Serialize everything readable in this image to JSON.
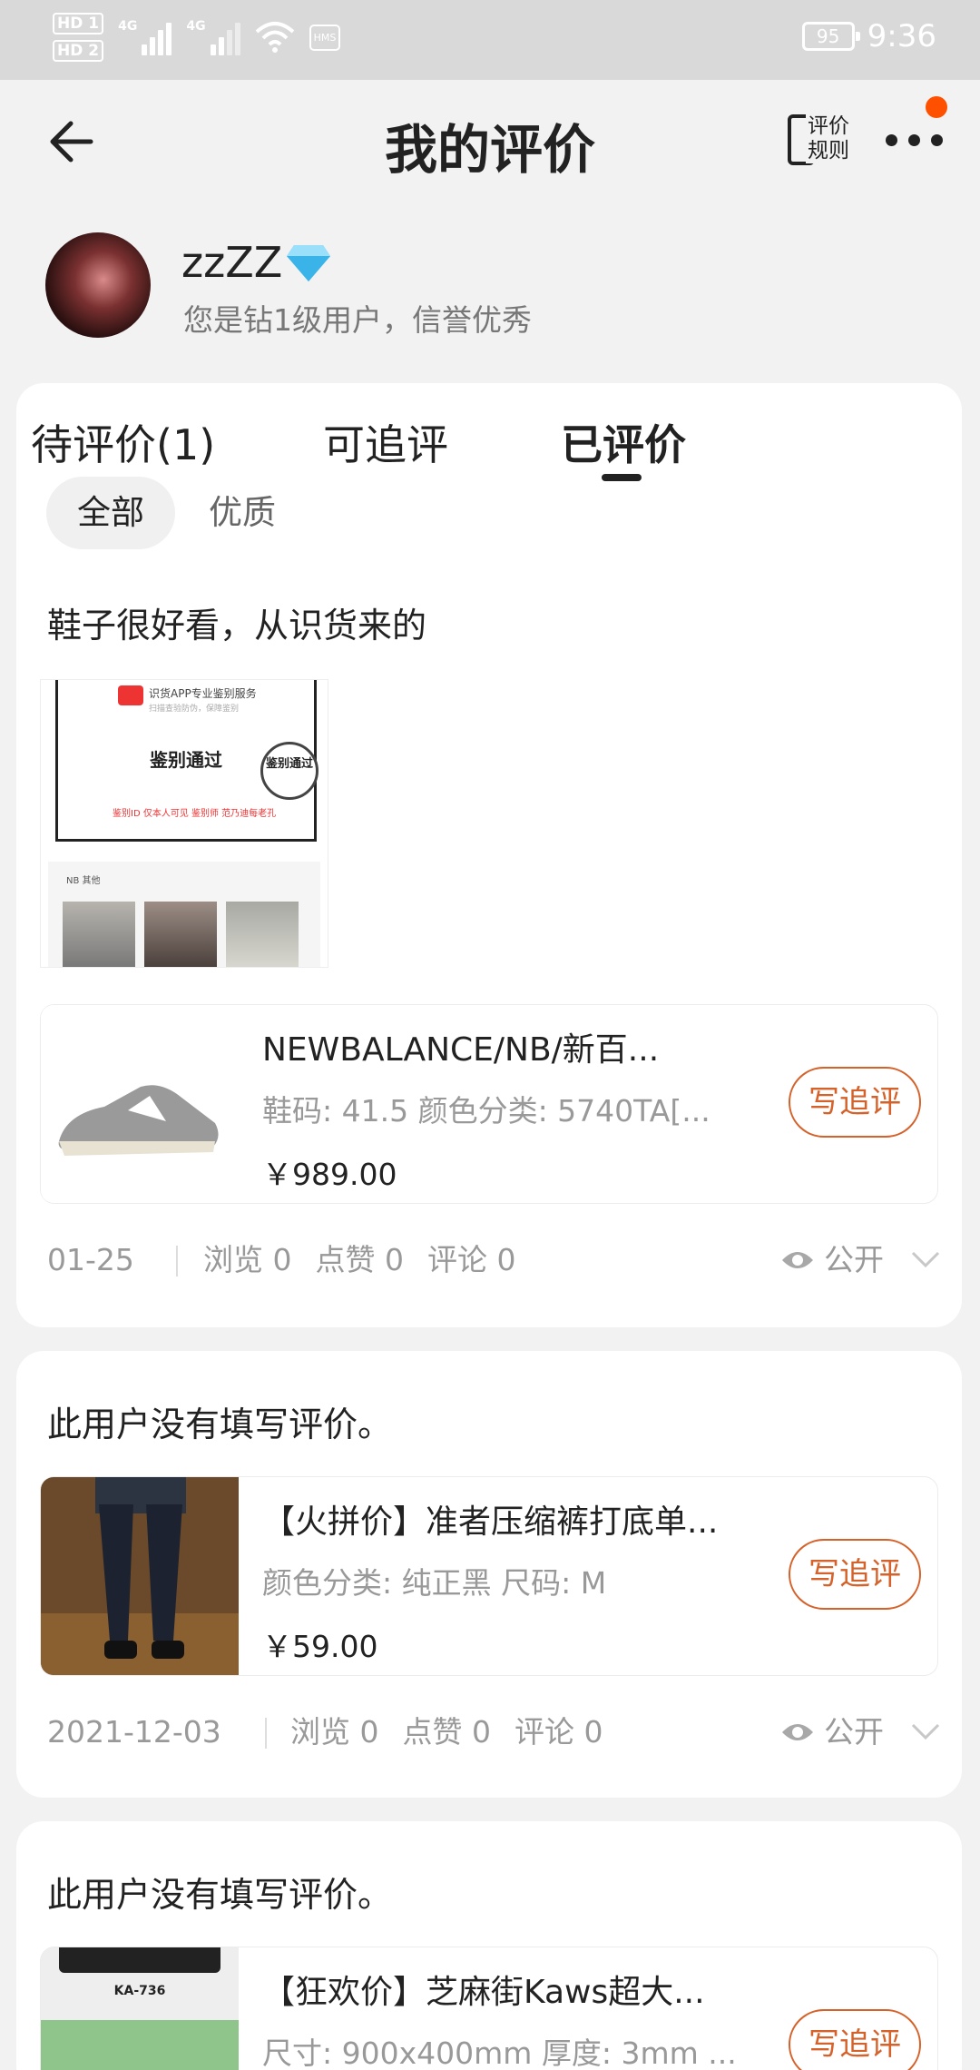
{
  "status_bar": {
    "hd1": "HD 1",
    "hd2": "HD 2",
    "net1": "4G",
    "net2": "4G",
    "hms": "HMS",
    "battery": "95",
    "time": "9:36"
  },
  "nav": {
    "title": "我的评价",
    "rules_label_line1": "评价",
    "rules_label_line2": "规则"
  },
  "profile": {
    "username": "zzZZ",
    "description": "您是钻1级用户，信誉优秀"
  },
  "tabs": [
    {
      "label": "待评价(1)"
    },
    {
      "label": "可追评"
    },
    {
      "label": "已评价"
    }
  ],
  "filters": [
    {
      "label": "全部"
    },
    {
      "label": "优质"
    }
  ],
  "reviews": [
    {
      "text": "鞋子很好看，从识货来的",
      "photo": {
        "header": "识货APP专业鉴别服务",
        "subheader": "扫描查验防伪，保障鉴别",
        "result": "鉴别通过",
        "stamp": "鉴别通过",
        "row": "鉴别ID  仅本人可见     鉴别师 范乃迪每老孔",
        "item": "NB 其他"
      },
      "product": {
        "name": "NEWBALANCE/NB/新百...",
        "spec": "鞋码: 41.5 颜色分类: 5740TA[...",
        "price": "￥989.00"
      },
      "button": "写追评",
      "date": "01-25",
      "views": "浏览 0",
      "likes": "点赞 0",
      "comments": "评论 0",
      "visibility": "公开"
    },
    {
      "text": "此用户没有填写评价。",
      "product": {
        "name": "【火拼价】准者压缩裤打底单...",
        "spec": "颜色分类: 纯正黑 尺码: M",
        "price": "￥59.00"
      },
      "button": "写追评",
      "date": "2021-12-03",
      "views": "浏览 0",
      "likes": "点赞 0",
      "comments": "评论 0",
      "visibility": "公开"
    },
    {
      "text": "此用户没有填写评价。",
      "product": {
        "name": "【狂欢价】芝麻街Kaws超大...",
        "spec": "尺寸: 900x400mm 厚度: 3mm ...",
        "image_label": "KA-736"
      },
      "button": "写追评"
    }
  ],
  "colors": {
    "accent": "#d4622a",
    "badge": "#ff5000",
    "background": "#f2f2f2"
  }
}
